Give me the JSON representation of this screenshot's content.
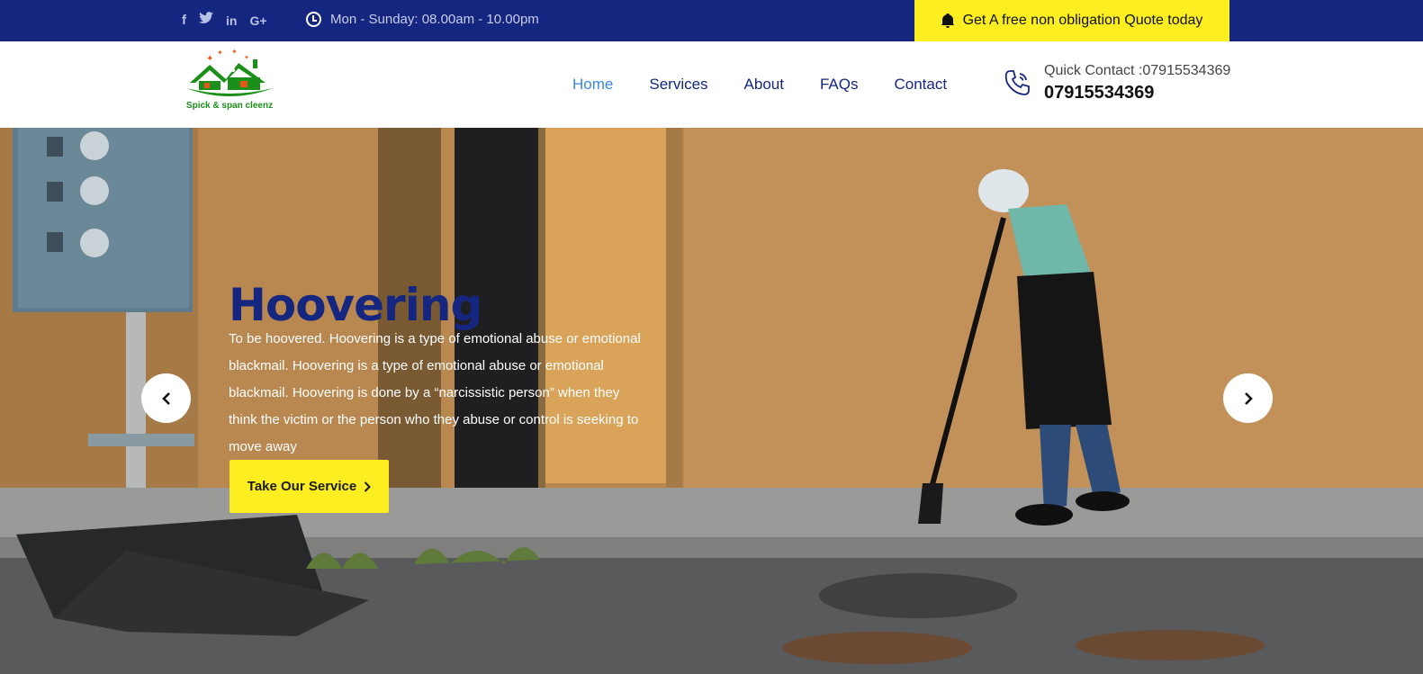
{
  "topbar": {
    "social": [
      {
        "icon": "facebook-icon",
        "glyph": "f"
      },
      {
        "icon": "twitter-icon",
        "glyph": "🐦"
      },
      {
        "icon": "linkedin-icon",
        "glyph": "in"
      },
      {
        "icon": "google-plus-icon",
        "glyph": "G+"
      }
    ],
    "hours": "Mon - Sunday: 08.00am - 10.00pm",
    "quote": "Get A free non obligation Quote today"
  },
  "header": {
    "logo_text": "Spick & span cleenz",
    "nav": [
      {
        "label": "Home",
        "active": true
      },
      {
        "label": "Services",
        "active": false
      },
      {
        "label": "About",
        "active": false
      },
      {
        "label": "FAQs",
        "active": false
      },
      {
        "label": "Contact",
        "active": false
      }
    ],
    "contact_label": "Quick Contact :07915534369",
    "contact_number": "07915534369"
  },
  "hero": {
    "title": "Hoovering",
    "text": "To be hoovered. Hoovering is a type of emotional abuse or emotional blackmail. Hoovering is a type of emotional abuse or emotional blackmail. Hoovering is done by a “narcissistic person” when they think the victim or the person who they abuse or control is seeking to move away",
    "cta": "Take Our Service",
    "prev_icon": "chevron-left-icon",
    "next_icon": "chevron-right-icon"
  },
  "colors": {
    "navy": "#142680",
    "yellow": "#fcee21",
    "active_link": "#3a86e8",
    "logo_green": "#1a8f1a"
  }
}
